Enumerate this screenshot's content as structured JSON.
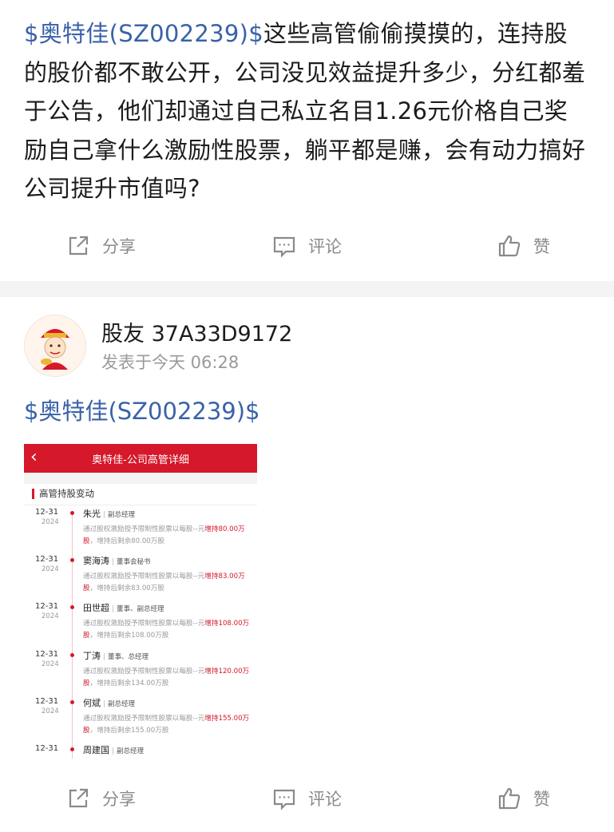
{
  "post1": {
    "stock_tag": "$奥特佳(SZ002239)$",
    "body": "这些高管偷偷摸摸的，连持股的股价都不敢公开，公司没见效益提升多少，分红都羞于公告，他们却通过自己私立名目1.26元价格自己奖励自己拿什么激励性股票，躺平都是赚，会有动力搞好公司提升市值吗?"
  },
  "actions": {
    "share": "分享",
    "comment": "评论",
    "like": "赞"
  },
  "post2": {
    "username": "股友 37A33D9172",
    "time": "发表于今天 06:28",
    "stock_tag": "$奥特佳(SZ002239)$"
  },
  "screenshot": {
    "back_glyph": "‹",
    "title": "奥特佳-公司高管详细",
    "section": "高管持股变动",
    "entries": [
      {
        "date": "12-31",
        "year": "2024",
        "name": "朱光",
        "role": "副总经理",
        "desc_pre": "通过股权激励授予限制性股票以每股--元",
        "desc_red": "增持80.00万股",
        "desc_post": "，增持后剩余80.00万股"
      },
      {
        "date": "12-31",
        "year": "2024",
        "name": "窦海涛",
        "role": "董事会秘书",
        "desc_pre": "通过股权激励授予限制性股票以每股--元",
        "desc_red": "增持83.00万股",
        "desc_post": "，增持后剩余83.00万股"
      },
      {
        "date": "12-31",
        "year": "2024",
        "name": "田世超",
        "role": "董事、副总经理",
        "desc_pre": "通过股权激励授予限制性股票以每股--元",
        "desc_red": "增持108.00万股",
        "desc_post": "，增持后剩余108.00万股"
      },
      {
        "date": "12-31",
        "year": "2024",
        "name": "丁涛",
        "role": "董事、总经理",
        "desc_pre": "通过股权激励授予限制性股票以每股--元",
        "desc_red": "增持120.00万股",
        "desc_post": "，增持后剩余134.00万股"
      },
      {
        "date": "12-31",
        "year": "2024",
        "name": "何斌",
        "role": "副总经理",
        "desc_pre": "通过股权激励授予限制性股票以每股--元",
        "desc_red": "增持155.00万股",
        "desc_post": "，增持后剩余155.00万股"
      },
      {
        "date": "12-31",
        "year": "",
        "name": "周建国",
        "role": "副总经理",
        "desc_pre": "",
        "desc_red": "",
        "desc_post": ""
      }
    ]
  },
  "colors": {
    "link": "#3a62a8",
    "accent_red": "#d5182a",
    "muted": "#8a8a8a"
  }
}
